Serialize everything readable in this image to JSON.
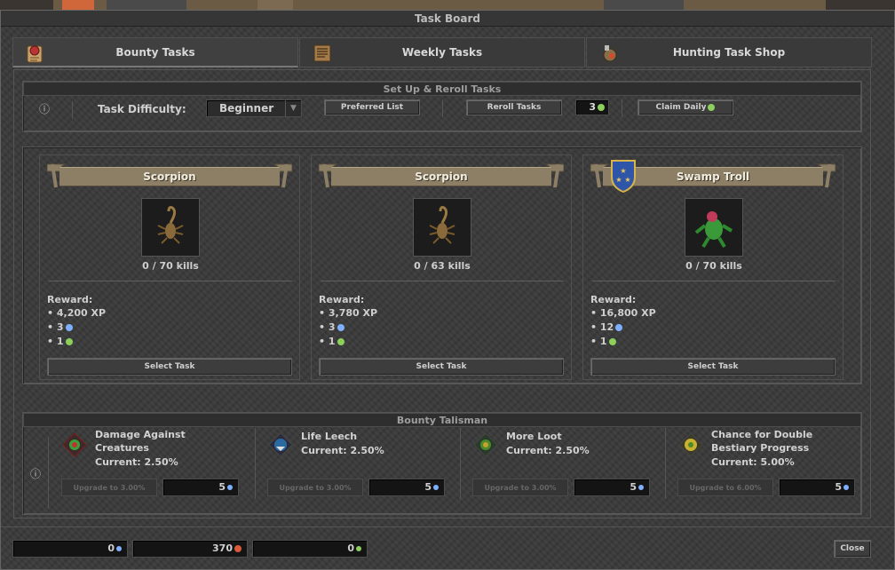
{
  "window": {
    "title": "Task Board"
  },
  "tabs": [
    {
      "label": "Bounty Tasks",
      "icon": "bounty-scroll-icon",
      "active": true
    },
    {
      "label": "Weekly Tasks",
      "icon": "weekly-book-icon",
      "active": false
    },
    {
      "label": "Hunting Task Shop",
      "icon": "shop-bag-icon",
      "active": false
    }
  ],
  "setup": {
    "title": "Set Up & Reroll Tasks",
    "info_glyph": "ⓘ",
    "difficulty_label": "Task Difficulty:",
    "difficulty_value": "Beginner",
    "preferred_list": "Preferred List",
    "reroll": "Reroll Tasks",
    "reroll_count": "3",
    "claim_daily": "Claim Daily"
  },
  "tasks": [
    {
      "name": "Scorpion",
      "kills": "0 / 70 kills",
      "reward_label": "Reward:",
      "xp": "• 4,200 XP",
      "points": "• 3",
      "tokens": "• 1",
      "select": "Select Task",
      "has_badge": false
    },
    {
      "name": "Scorpion",
      "kills": "0 / 63 kills",
      "reward_label": "Reward:",
      "xp": "• 3,780 XP",
      "points": "• 3",
      "tokens": "• 1",
      "select": "Select Task",
      "has_badge": false
    },
    {
      "name": "Swamp Troll",
      "kills": "0 / 70 kills",
      "reward_label": "Reward:",
      "xp": "• 16,800 XP",
      "points": "• 12",
      "tokens": "• 1",
      "select": "Select Task",
      "has_badge": true
    }
  ],
  "talisman": {
    "title": "Bounty Talisman",
    "info_glyph": "ⓘ",
    "items": [
      {
        "title1": "Damage Against",
        "title2": "Creatures",
        "current": "Current: 2.50%",
        "upgrade": "Upgrade to 3.00%",
        "cost": "5"
      },
      {
        "title1": "Life Leech",
        "title2": "",
        "current": "Current: 2.50%",
        "upgrade": "Upgrade to 3.00%",
        "cost": "5"
      },
      {
        "title1": "More Loot",
        "title2": "",
        "current": "Current: 2.50%",
        "upgrade": "Upgrade to 3.00%",
        "cost": "5"
      },
      {
        "title1": "Chance for Double",
        "title2": "Bestiary Progress",
        "current": "Current: 5.00%",
        "upgrade": "Upgrade to 6.00%",
        "cost": "5"
      }
    ]
  },
  "footer": {
    "points": "0",
    "hunting": "370",
    "tokens": "0",
    "close": "Close"
  },
  "colors": {
    "banner": "#8d7f66",
    "points_dot": "#7fb0ff",
    "token_dot": "#8ccf5a",
    "hunting_dot": "#d85a3a"
  }
}
